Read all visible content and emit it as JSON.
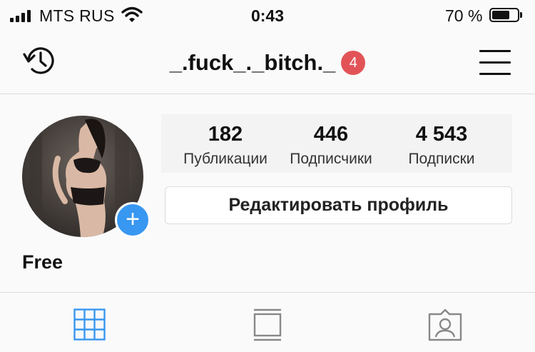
{
  "status_bar": {
    "carrier": "MTS RUS",
    "time": "0:43",
    "battery_percent_text": "70 %",
    "battery_level": 0.7,
    "signal_bars_filled": 4
  },
  "nav": {
    "username": "_.fuck_._bitch._",
    "notification_count": "4",
    "icons": {
      "left": "history-icon",
      "right": "menu-icon"
    }
  },
  "profile": {
    "stats": [
      {
        "value": "182",
        "label": "Публикации"
      },
      {
        "value": "446",
        "label": "Подписчики"
      },
      {
        "value": "4 543",
        "label": "Подписки"
      }
    ],
    "edit_button": "Редактировать профиль",
    "bio": "Free"
  },
  "tabs": [
    {
      "icon": "grid-icon",
      "active": true
    },
    {
      "icon": "feed-icon",
      "active": false
    },
    {
      "icon": "tagged-icon",
      "active": false
    }
  ],
  "colors": {
    "accent": "#3897f0",
    "badge": "#e25357"
  }
}
